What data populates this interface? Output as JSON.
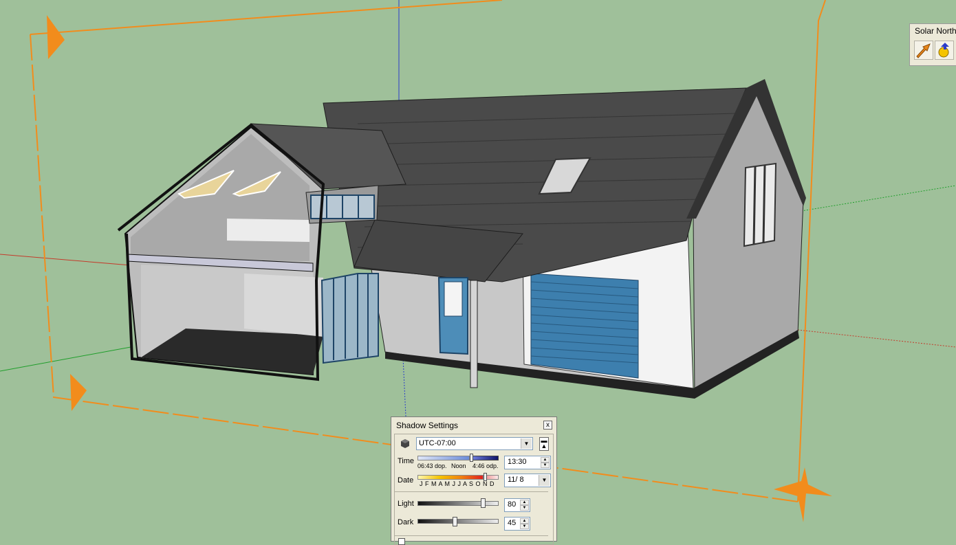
{
  "toolbar": {
    "title": "Solar North",
    "buttons": [
      {
        "icon": "north-arrow-icon"
      },
      {
        "icon": "solar-north-angle-icon"
      }
    ]
  },
  "shadow_settings": {
    "title": "Shadow Settings",
    "close_glyph": "x",
    "timezone": "UTC-07:00",
    "time_label": "Time",
    "time_start": "06:43 dop.",
    "time_noon": "Noon",
    "time_end": "4:46 odp.",
    "time_value": "13:30",
    "date_label": "Date",
    "months": "J F M A M J J A S O N D",
    "date_value": "11/ 8",
    "light_label": "Light",
    "light_value": "80",
    "dark_label": "Dark",
    "dark_value": "45"
  },
  "colors": {
    "sky": "#9fc09a",
    "section_plane": "#f28c1c",
    "roof": "#4a4a4a",
    "wall": "#c8c8c8",
    "garage_door": "#3d7fae"
  }
}
